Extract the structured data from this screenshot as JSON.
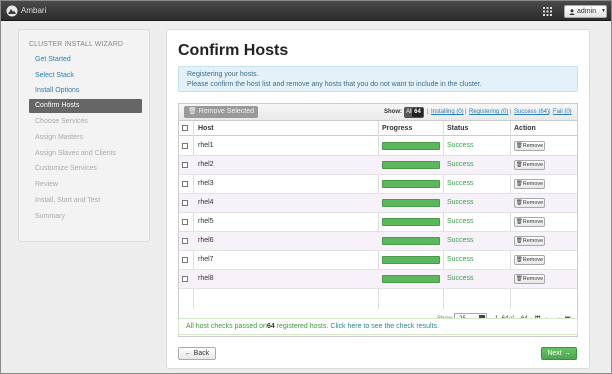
{
  "app": {
    "name": "Ambari",
    "user": "admin"
  },
  "sidebar": {
    "title": "CLUSTER INSTALL WIZARD",
    "items": [
      {
        "label": "Get Started",
        "state": "done"
      },
      {
        "label": "Select Stack",
        "state": "done"
      },
      {
        "label": "Install Options",
        "state": "done"
      },
      {
        "label": "Confirm Hosts",
        "state": "active"
      },
      {
        "label": "Choose Services",
        "state": "pending"
      },
      {
        "label": "Assign Masters",
        "state": "pending"
      },
      {
        "label": "Assign Slaves and Clients",
        "state": "pending"
      },
      {
        "label": "Customize Services",
        "state": "pending"
      },
      {
        "label": "Review",
        "state": "pending"
      },
      {
        "label": "Install, Start and Test",
        "state": "pending"
      },
      {
        "label": "Summary",
        "state": "pending"
      }
    ]
  },
  "main": {
    "title": "Confirm Hosts",
    "info_line1": "Registering your hosts.",
    "info_line2": "Please confirm the host list and remove any hosts that you do not want to include in the cluster.",
    "toolbar": {
      "remove_selected": "Remove Selected",
      "show_label": "Show:",
      "all_label": "All",
      "all_count": "64",
      "installing": "Installing (0)",
      "registering": "Registering (0)",
      "success": "Success (64)",
      "fail": "Fail (0)",
      "separator": "|"
    },
    "columns": [
      "Host",
      "Progress",
      "Status",
      "Action"
    ],
    "rows": [
      {
        "host": "rhel1",
        "progress": 1.0,
        "status": "Success",
        "action": "Remove"
      },
      {
        "host": "rhel2",
        "progress": 1.0,
        "status": "Success",
        "action": "Remove"
      },
      {
        "host": "rhel3",
        "progress": 1.0,
        "status": "Success",
        "action": "Remove"
      },
      {
        "host": "rhel4",
        "progress": 1.0,
        "status": "Success",
        "action": "Remove"
      },
      {
        "host": "rhel5",
        "progress": 1.0,
        "status": "Success",
        "action": "Remove"
      },
      {
        "host": "rhel6",
        "progress": 1.0,
        "status": "Success",
        "action": "Remove"
      },
      {
        "host": "rhel7",
        "progress": 1.0,
        "status": "Success",
        "action": "Remove"
      },
      {
        "host": "rhel8",
        "progress": 1.0,
        "status": "Success",
        "action": "Remove"
      }
    ],
    "pager": {
      "show_label": "Show:",
      "page_size": "25",
      "range": "1–64",
      "of_label": "of",
      "total": "64"
    },
    "checks": {
      "prefix": "All host checks passed on",
      "count": "64",
      "suffix": " registered hosts.",
      "link": "Click here to see the check results."
    },
    "back_label": "← Back",
    "next_label": "Next →"
  },
  "colors": {
    "success": "#3aa14a",
    "progress": "#5cb85c",
    "link": "#2a7fb3",
    "navbar": "#333333"
  }
}
